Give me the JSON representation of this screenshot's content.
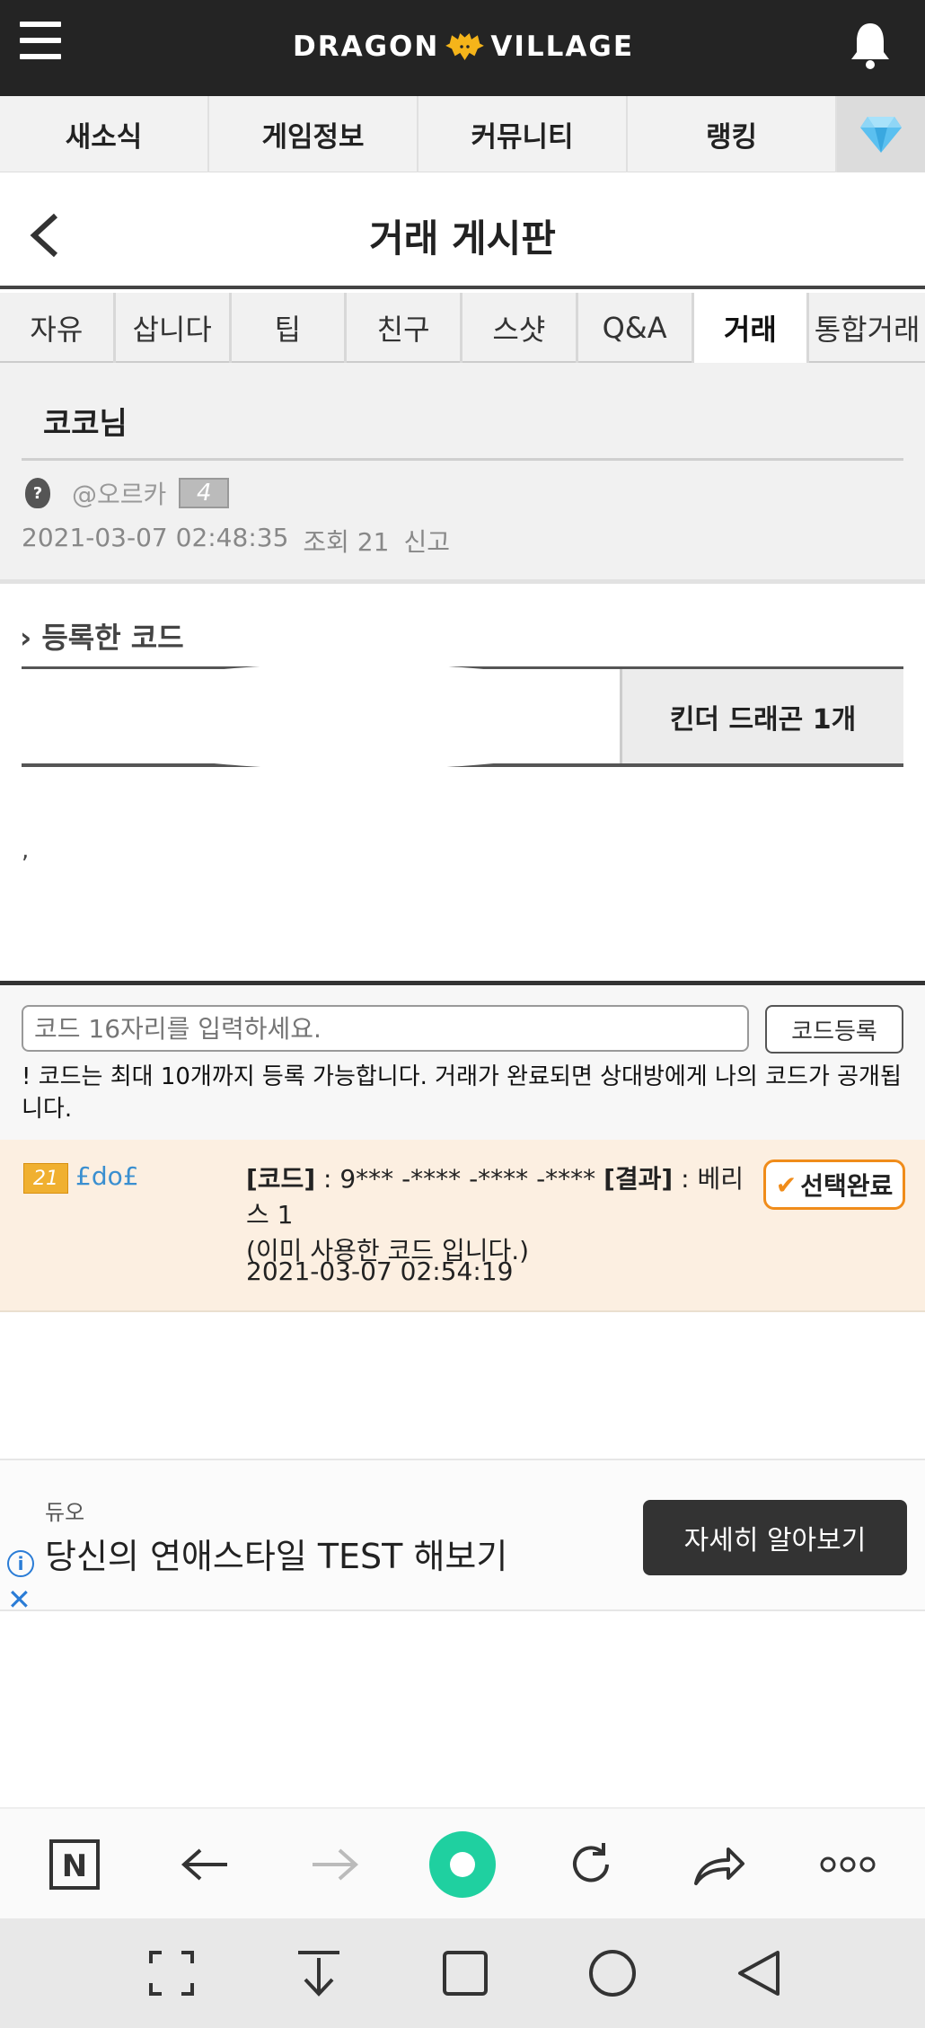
{
  "header": {
    "logo_left": "DRAGON",
    "logo_right": "VILLAGE",
    "menu_icon": "hamburger-menu-icon",
    "bell_icon": "notification-bell-icon"
  },
  "nav": {
    "items": [
      "새소식",
      "게임정보",
      "커뮤니티",
      "랭킹"
    ],
    "gem_icon": "diamond-gem-icon"
  },
  "board": {
    "title": "거래 게시판"
  },
  "categories": {
    "tabs": [
      "자유",
      "삽니다",
      "팁",
      "친구",
      "스샷",
      "Q&A",
      "거래",
      "통합거래"
    ],
    "active": "거래"
  },
  "post": {
    "title": "코코님",
    "author_name": "@오르카",
    "author_avatar": "?",
    "author_level": "4",
    "datetime": "2021-03-07 02:48:35",
    "views": "조회 21",
    "report": "신고"
  },
  "registered": {
    "label": "등록한 코드",
    "item": "킨더 드래곤 1개"
  },
  "body_text": ",",
  "code_entry": {
    "placeholder": "코드 16자리를 입력하세요.",
    "button_label": "코드등록",
    "note": "! 코드는 최대 10개까지 등록 가능합니다. 거래가 완료되면 상대방에게 나의 코드가 공개됩니다."
  },
  "offer": {
    "user_level": "21",
    "user_name": "£do£",
    "code_label": "[코드]",
    "code_value": " : 9*** -**** -**** -**** ",
    "result_label": "[결과]",
    "result_value": " : 베리스 1",
    "used_note": "(이미 사용한 코드 입니다.)",
    "datetime": "2021-03-07 02:54:19",
    "select_label": "선택완료"
  },
  "ad": {
    "brand": "듀오",
    "headline": "당신의 연애스타일 TEST 해보기",
    "cta": "자세히 알아보기"
  },
  "colors": {
    "header_bg": "#242424",
    "logo_gold": "#f4b41a",
    "offer_bg": "#fcefe1",
    "select_orange": "#f08c1a",
    "browser_green": "#1fd0a0",
    "user_link": "#3a8fd0"
  }
}
